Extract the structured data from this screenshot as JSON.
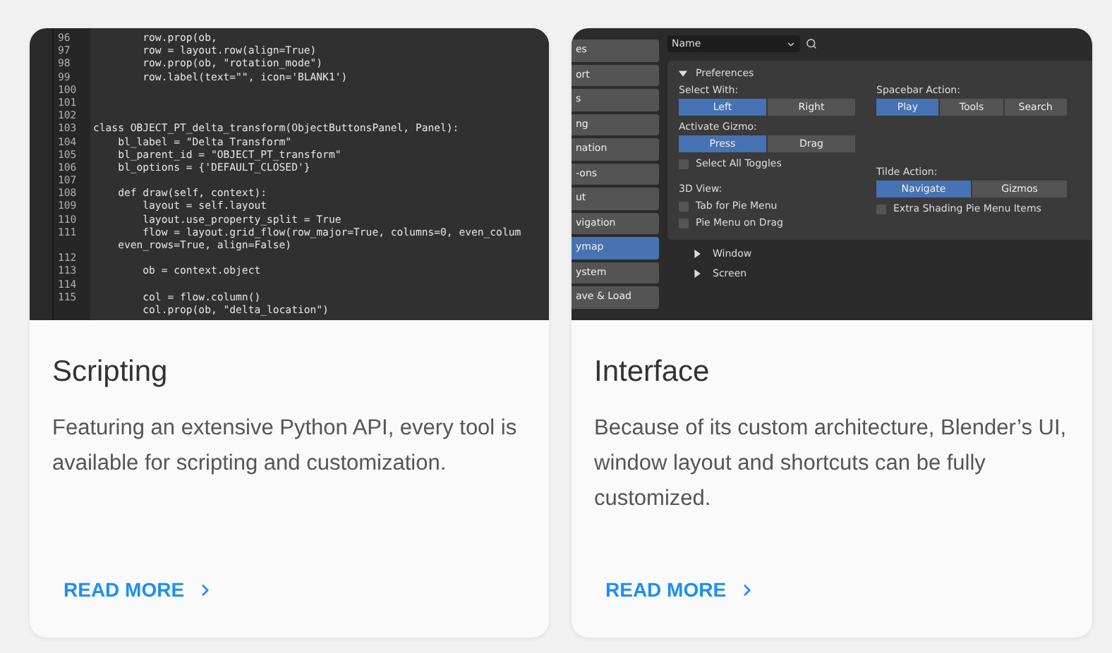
{
  "cards": [
    {
      "title": "Scripting",
      "description": "Featuring an extensive Python API, every tool is available for scripting and customization.",
      "link": {
        "label": "READ MORE"
      },
      "preview": {
        "kind": "code",
        "lines": [
          {
            "number": "96",
            "code": "        row.prop(ob,"
          },
          {
            "number": "97",
            "code": "        row = layout.row(align=True)"
          },
          {
            "number": "98",
            "code": "        row.prop(ob, \"rotation_mode\")"
          },
          {
            "number": "99",
            "code": "        row.label(text=\"\", icon='BLANK1')"
          },
          {
            "number": "100"
          },
          {
            "number": "101"
          },
          {
            "number": "102"
          },
          {
            "number": "103",
            "code": "class OBJECT_PT_delta_transform(ObjectButtonsPanel, Panel):"
          },
          {
            "number": "104",
            "code": "    bl_label = \"Delta Transform\""
          },
          {
            "number": "105",
            "code": "    bl_parent_id = \"OBJECT_PT_transform\""
          },
          {
            "number": "106",
            "code": "    bl_options = {'DEFAULT_CLOSED'}"
          },
          {
            "number": "107"
          },
          {
            "number": "108",
            "code": "    def draw(self, context):"
          },
          {
            "number": "109",
            "code": "        layout = self.layout"
          },
          {
            "number": "110",
            "code": "        layout.use_property_split = True"
          },
          {
            "number": "111",
            "code": "        flow = layout.grid_flow(row_major=True, columns=0, even_colum"
          },
          {
            "code": "    even_rows=True, align=False)"
          },
          {
            "number": "112"
          },
          {
            "number": "113",
            "code": "        ob = context.object"
          },
          {
            "number": "114"
          },
          {
            "number": "115",
            "code": "        col = flow.column()"
          },
          {
            "code": "        col.prop(ob, \"delta_location\")"
          }
        ]
      }
    },
    {
      "title": "Interface",
      "description": "Because of its custom architecture, Blender’s UI, window layout and shortcuts can be fully customized.",
      "link": {
        "label": "READ MORE"
      },
      "preview": {
        "kind": "preferences",
        "sidebar": [
          {
            "label": "es",
            "selected": false
          },
          {
            "label": "ort",
            "selected": false
          },
          {
            "label": "s",
            "selected": false
          },
          {
            "label": "ng",
            "selected": false
          },
          {
            "label": "nation",
            "selected": false
          },
          {
            "label": "-ons",
            "selected": false
          },
          {
            "label": "ut",
            "selected": false
          },
          {
            "label": "vigation",
            "selected": false
          },
          {
            "label": "ymap",
            "selected": true
          },
          {
            "label": "ystem",
            "selected": false
          },
          {
            "label": "ave & Load",
            "selected": false
          }
        ],
        "filter": {
          "value": "Name"
        },
        "section": {
          "label": "Preferences",
          "expanded": true
        },
        "columns": [
          [
            {
              "kind": "choice",
              "label": "Select With:",
              "options": [
                {
                  "label": "Left",
                  "selected": true
                },
                {
                  "label": "Right",
                  "selected": false
                }
              ]
            },
            {
              "kind": "choice",
              "label": "Activate Gizmo:",
              "options": [
                {
                  "label": "Press",
                  "selected": true
                },
                {
                  "label": "Drag",
                  "selected": false
                }
              ]
            },
            {
              "kind": "checkbox",
              "label": "Select All Toggles",
              "checked": false
            },
            {
              "kind": "heading",
              "label": "3D View:"
            },
            {
              "kind": "checkbox",
              "label": "Tab for Pie Menu",
              "checked": false
            },
            {
              "kind": "checkbox",
              "label": "Pie Menu on Drag",
              "checked": false
            }
          ],
          [
            {
              "kind": "choice",
              "label": "Spacebar Action:",
              "options": [
                {
                  "label": "Play",
                  "selected": true
                },
                {
                  "label": "Tools",
                  "selected": false
                },
                {
                  "label": "Search",
                  "selected": false
                }
              ]
            },
            {
              "kind": "spacer"
            },
            {
              "kind": "choice",
              "label": "Tilde Action:",
              "options": [
                {
                  "label": "Navigate",
                  "selected": true
                },
                {
                  "label": "Gizmos",
                  "selected": false
                }
              ]
            },
            {
              "kind": "checkbox",
              "label": "Extra Shading Pie Menu Items",
              "checked": false
            }
          ]
        ],
        "subsections": [
          {
            "label": "Window",
            "expanded": false
          },
          {
            "label": "Screen",
            "expanded": false
          }
        ]
      }
    }
  ]
}
